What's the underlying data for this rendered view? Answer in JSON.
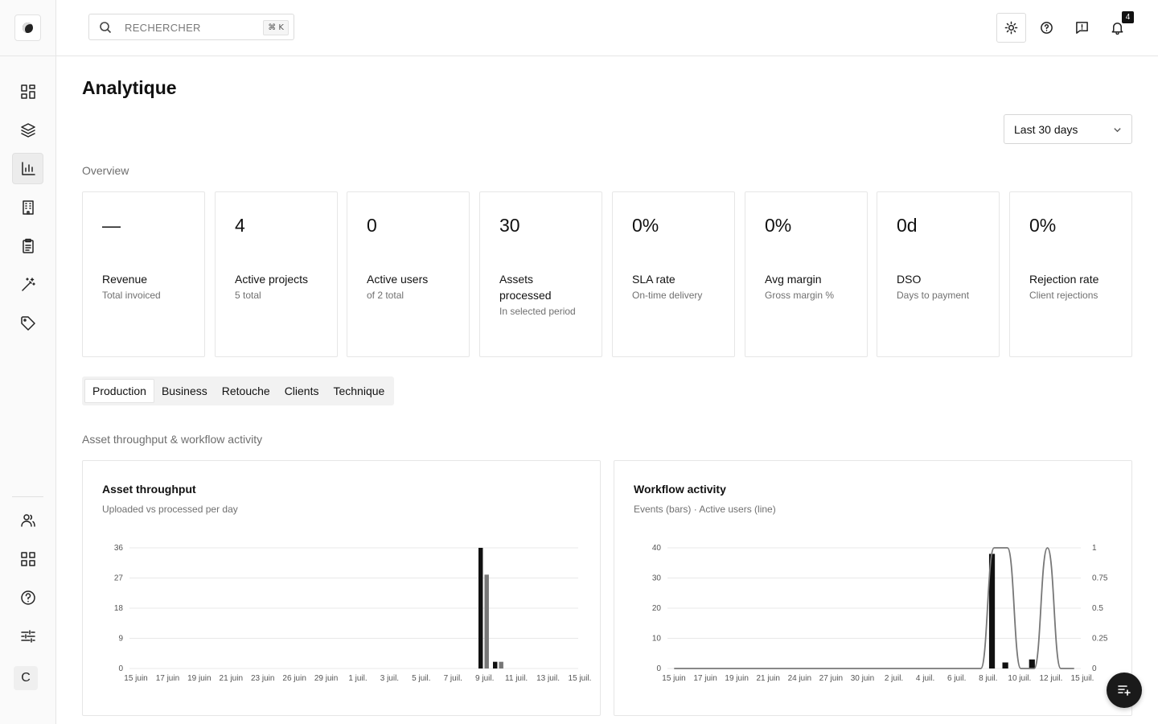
{
  "topbar": {
    "search_placeholder": "RECHERCHER",
    "search_shortcut": "⌘ K",
    "notification_count": "4"
  },
  "sidebar": {
    "nav_icons": [
      "grid-icon",
      "layers-icon",
      "bar-chart-icon",
      "building-icon",
      "clipboard-icon",
      "magic-wand-icon",
      "tag-icon"
    ],
    "bottom_icons": [
      "users-icon",
      "apps-grid-icon",
      "help-circle-icon",
      "sliders-icon"
    ],
    "avatar_initial": "C"
  },
  "page": {
    "title": "Analytique",
    "date_range": "Last 30 days",
    "overview_label": "Overview",
    "section_label": "Asset throughput & workflow activity"
  },
  "kpis": [
    {
      "value": "—",
      "label": "Revenue",
      "sub": "Total invoiced"
    },
    {
      "value": "4",
      "label": "Active projects",
      "sub": "5 total"
    },
    {
      "value": "0",
      "label": "Active users",
      "sub": "of 2 total"
    },
    {
      "value": "30",
      "label": "Assets processed",
      "sub": "In selected period"
    },
    {
      "value": "0%",
      "label": "SLA rate",
      "sub": "On-time delivery"
    },
    {
      "value": "0%",
      "label": "Avg margin",
      "sub": "Gross margin %"
    },
    {
      "value": "0d",
      "label": "DSO",
      "sub": "Days to payment"
    },
    {
      "value": "0%",
      "label": "Rejection rate",
      "sub": "Client rejections"
    }
  ],
  "tabs": [
    "Production",
    "Business",
    "Retouche",
    "Clients",
    "Technique"
  ],
  "active_tab": "Production",
  "cards": {
    "throughput": {
      "title": "Asset throughput",
      "sub": "Uploaded vs processed per day"
    },
    "workflow": {
      "title": "Workflow activity",
      "sub": "Events (bars) · Active users (line)"
    }
  },
  "chart_data": [
    {
      "type": "bar",
      "title": "Asset throughput",
      "subtitle": "Uploaded vs processed per day",
      "ylim": [
        0,
        36
      ],
      "yticks": [
        0,
        9,
        18,
        27,
        36
      ],
      "x_tick_labels": [
        "15 juin",
        "17 juin",
        "19 juin",
        "21 juin",
        "23 juin",
        "26 juin",
        "29 juin",
        "1 juil.",
        "3 juil.",
        "5 juil.",
        "7 juil.",
        "9 juil.",
        "11 juil.",
        "13 juil.",
        "15 juil."
      ],
      "num_days": 31,
      "series": [
        {
          "values_by_day": {
            "24": 36,
            "25": 2
          },
          "color": "#111111"
        },
        {
          "values_by_day": {
            "24": 28,
            "25": 2
          },
          "color": "#777777"
        }
      ],
      "grid": true
    },
    {
      "type": "bar",
      "title": "Workflow activity",
      "subtitle": "Events (bars) · Active users (line)",
      "ylim": [
        0,
        40
      ],
      "yticks": [
        0,
        10,
        20,
        30,
        40
      ],
      "y2lim": [
        0,
        1
      ],
      "y2ticks": [
        "0",
        "0.25",
        "0.5",
        "0.75",
        "1"
      ],
      "x_tick_labels": [
        "15 juin",
        "17 juin",
        "19 juin",
        "21 juin",
        "24 juin",
        "27 juin",
        "30 juin",
        "2 juil.",
        "4 juil.",
        "6 juil.",
        "8 juil.",
        "10 juil.",
        "12 juil.",
        "15 juil."
      ],
      "num_days": 31,
      "series": [
        {
          "type": "bar",
          "values_by_day": {
            "24": 38,
            "25": 2,
            "27": 3
          },
          "color": "#111111"
        },
        {
          "type": "line",
          "values_by_day": {
            "24": 1,
            "25": 1,
            "28": 1
          },
          "color": "#777777"
        }
      ],
      "grid": true
    }
  ]
}
